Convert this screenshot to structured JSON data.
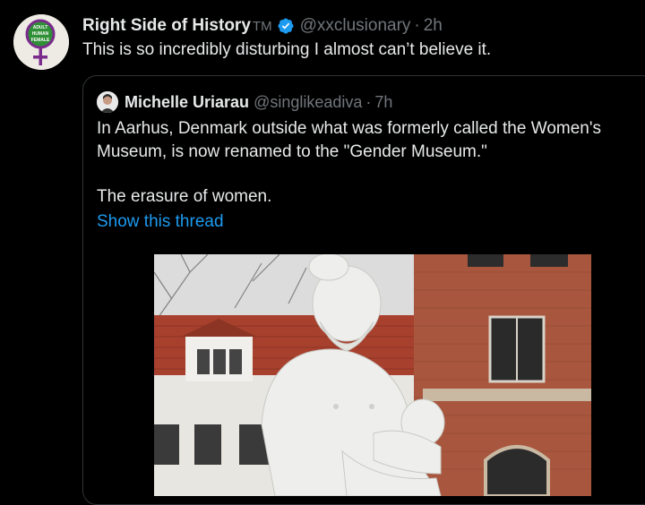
{
  "tweet": {
    "display_name": "Right Side of History",
    "tm": "TM",
    "handle": "@xxclusionary",
    "separator": "·",
    "time": "2h",
    "text": "This is so incredibly disturbing I almost can’t believe it.",
    "avatar_text": [
      "ADULT",
      "HUMAN",
      "FEMALE"
    ],
    "verified_icon": "verified-badge-icon",
    "accent_color": "#1d9bf0"
  },
  "quote": {
    "display_name": "Michelle Uriarau",
    "handle": "@singlikeadiva",
    "separator": "·",
    "time": "7h",
    "text_1": "In Aarhus, Denmark outside what was formerly called the Women's Museum, is now renamed to the \"Gender Museum.\"",
    "text_2": "The erasure of women.",
    "show_thread": "Show this thread"
  }
}
